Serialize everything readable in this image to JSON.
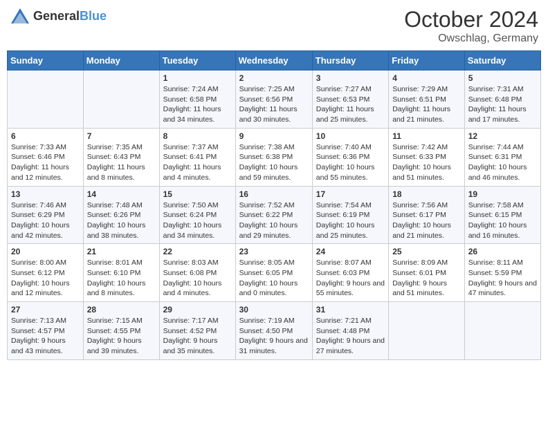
{
  "header": {
    "logo_general": "General",
    "logo_blue": "Blue",
    "title": "October 2024",
    "subtitle": "Owschlag, Germany"
  },
  "days_of_week": [
    "Sunday",
    "Monday",
    "Tuesday",
    "Wednesday",
    "Thursday",
    "Friday",
    "Saturday"
  ],
  "weeks": [
    {
      "cells": [
        {
          "day": null
        },
        {
          "day": null
        },
        {
          "day": "1",
          "sunrise": "Sunrise: 7:24 AM",
          "sunset": "Sunset: 6:58 PM",
          "daylight": "Daylight: 11 hours and 34 minutes."
        },
        {
          "day": "2",
          "sunrise": "Sunrise: 7:25 AM",
          "sunset": "Sunset: 6:56 PM",
          "daylight": "Daylight: 11 hours and 30 minutes."
        },
        {
          "day": "3",
          "sunrise": "Sunrise: 7:27 AM",
          "sunset": "Sunset: 6:53 PM",
          "daylight": "Daylight: 11 hours and 25 minutes."
        },
        {
          "day": "4",
          "sunrise": "Sunrise: 7:29 AM",
          "sunset": "Sunset: 6:51 PM",
          "daylight": "Daylight: 11 hours and 21 minutes."
        },
        {
          "day": "5",
          "sunrise": "Sunrise: 7:31 AM",
          "sunset": "Sunset: 6:48 PM",
          "daylight": "Daylight: 11 hours and 17 minutes."
        }
      ]
    },
    {
      "cells": [
        {
          "day": "6",
          "sunrise": "Sunrise: 7:33 AM",
          "sunset": "Sunset: 6:46 PM",
          "daylight": "Daylight: 11 hours and 12 minutes."
        },
        {
          "day": "7",
          "sunrise": "Sunrise: 7:35 AM",
          "sunset": "Sunset: 6:43 PM",
          "daylight": "Daylight: 11 hours and 8 minutes."
        },
        {
          "day": "8",
          "sunrise": "Sunrise: 7:37 AM",
          "sunset": "Sunset: 6:41 PM",
          "daylight": "Daylight: 11 hours and 4 minutes."
        },
        {
          "day": "9",
          "sunrise": "Sunrise: 7:38 AM",
          "sunset": "Sunset: 6:38 PM",
          "daylight": "Daylight: 10 hours and 59 minutes."
        },
        {
          "day": "10",
          "sunrise": "Sunrise: 7:40 AM",
          "sunset": "Sunset: 6:36 PM",
          "daylight": "Daylight: 10 hours and 55 minutes."
        },
        {
          "day": "11",
          "sunrise": "Sunrise: 7:42 AM",
          "sunset": "Sunset: 6:33 PM",
          "daylight": "Daylight: 10 hours and 51 minutes."
        },
        {
          "day": "12",
          "sunrise": "Sunrise: 7:44 AM",
          "sunset": "Sunset: 6:31 PM",
          "daylight": "Daylight: 10 hours and 46 minutes."
        }
      ]
    },
    {
      "cells": [
        {
          "day": "13",
          "sunrise": "Sunrise: 7:46 AM",
          "sunset": "Sunset: 6:29 PM",
          "daylight": "Daylight: 10 hours and 42 minutes."
        },
        {
          "day": "14",
          "sunrise": "Sunrise: 7:48 AM",
          "sunset": "Sunset: 6:26 PM",
          "daylight": "Daylight: 10 hours and 38 minutes."
        },
        {
          "day": "15",
          "sunrise": "Sunrise: 7:50 AM",
          "sunset": "Sunset: 6:24 PM",
          "daylight": "Daylight: 10 hours and 34 minutes."
        },
        {
          "day": "16",
          "sunrise": "Sunrise: 7:52 AM",
          "sunset": "Sunset: 6:22 PM",
          "daylight": "Daylight: 10 hours and 29 minutes."
        },
        {
          "day": "17",
          "sunrise": "Sunrise: 7:54 AM",
          "sunset": "Sunset: 6:19 PM",
          "daylight": "Daylight: 10 hours and 25 minutes."
        },
        {
          "day": "18",
          "sunrise": "Sunrise: 7:56 AM",
          "sunset": "Sunset: 6:17 PM",
          "daylight": "Daylight: 10 hours and 21 minutes."
        },
        {
          "day": "19",
          "sunrise": "Sunrise: 7:58 AM",
          "sunset": "Sunset: 6:15 PM",
          "daylight": "Daylight: 10 hours and 16 minutes."
        }
      ]
    },
    {
      "cells": [
        {
          "day": "20",
          "sunrise": "Sunrise: 8:00 AM",
          "sunset": "Sunset: 6:12 PM",
          "daylight": "Daylight: 10 hours and 12 minutes."
        },
        {
          "day": "21",
          "sunrise": "Sunrise: 8:01 AM",
          "sunset": "Sunset: 6:10 PM",
          "daylight": "Daylight: 10 hours and 8 minutes."
        },
        {
          "day": "22",
          "sunrise": "Sunrise: 8:03 AM",
          "sunset": "Sunset: 6:08 PM",
          "daylight": "Daylight: 10 hours and 4 minutes."
        },
        {
          "day": "23",
          "sunrise": "Sunrise: 8:05 AM",
          "sunset": "Sunset: 6:05 PM",
          "daylight": "Daylight: 10 hours and 0 minutes."
        },
        {
          "day": "24",
          "sunrise": "Sunrise: 8:07 AM",
          "sunset": "Sunset: 6:03 PM",
          "daylight": "Daylight: 9 hours and 55 minutes."
        },
        {
          "day": "25",
          "sunrise": "Sunrise: 8:09 AM",
          "sunset": "Sunset: 6:01 PM",
          "daylight": "Daylight: 9 hours and 51 minutes."
        },
        {
          "day": "26",
          "sunrise": "Sunrise: 8:11 AM",
          "sunset": "Sunset: 5:59 PM",
          "daylight": "Daylight: 9 hours and 47 minutes."
        }
      ]
    },
    {
      "cells": [
        {
          "day": "27",
          "sunrise": "Sunrise: 7:13 AM",
          "sunset": "Sunset: 4:57 PM",
          "daylight": "Daylight: 9 hours and 43 minutes."
        },
        {
          "day": "28",
          "sunrise": "Sunrise: 7:15 AM",
          "sunset": "Sunset: 4:55 PM",
          "daylight": "Daylight: 9 hours and 39 minutes."
        },
        {
          "day": "29",
          "sunrise": "Sunrise: 7:17 AM",
          "sunset": "Sunset: 4:52 PM",
          "daylight": "Daylight: 9 hours and 35 minutes."
        },
        {
          "day": "30",
          "sunrise": "Sunrise: 7:19 AM",
          "sunset": "Sunset: 4:50 PM",
          "daylight": "Daylight: 9 hours and 31 minutes."
        },
        {
          "day": "31",
          "sunrise": "Sunrise: 7:21 AM",
          "sunset": "Sunset: 4:48 PM",
          "daylight": "Daylight: 9 hours and 27 minutes."
        },
        {
          "day": null
        },
        {
          "day": null
        }
      ]
    }
  ]
}
